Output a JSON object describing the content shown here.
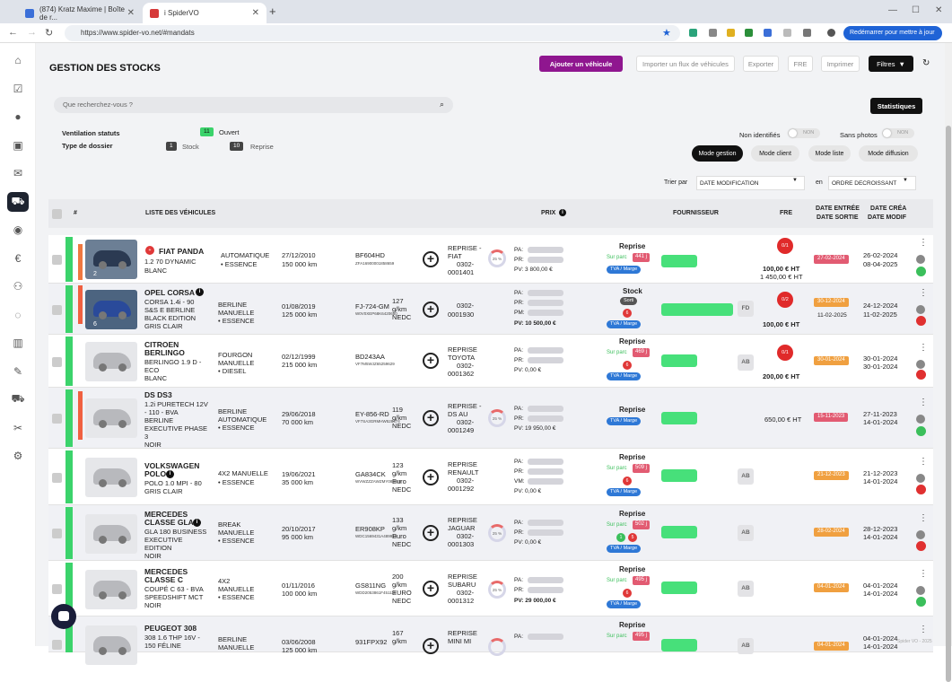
{
  "browser": {
    "tabs": [
      {
        "label": "(874) Kratz Maxime | Boîte de r..."
      },
      {
        "label": "i SpiderVO"
      }
    ],
    "url": "https://www.spider-vo.net/#mandats",
    "update_label": "Redémarrer pour mettre à jour"
  },
  "page": {
    "title": "GESTION DES STOCKS",
    "buttons": {
      "add": "Ajouter un véhicule",
      "import": "Importer un flux de véhicules",
      "export": "Exporter",
      "fre": "FRE",
      "print": "Imprimer",
      "filters": "Filtres"
    },
    "search_placeholder": "Que recherchez-vous ?",
    "stats": "Statistiques",
    "ventilation_label": "Ventilation statuts",
    "ventilation_count": "11",
    "ventilation_status": "Ouvert",
    "dossier_label": "Type de dossier",
    "dossier_stock_count": "1",
    "dossier_stock": "Stock",
    "dossier_reprise_count": "10",
    "dossier_reprise": "Reprise",
    "non_identifies": "Non identifiés",
    "sans_photos": "Sans photos",
    "toggle_off": "NON",
    "modes": [
      "Mode gestion",
      "Mode client",
      "Mode liste",
      "Mode diffusion"
    ],
    "sort_label": "Trier par",
    "sort_value": "DATE MODIFICATION",
    "order_label": "en",
    "order_value": "ORDRE DECROISSANT",
    "copyright": "Spider VO - 2025"
  },
  "table": {
    "headers": {
      "num": "#",
      "vehicles": "LISTE DES VÉHICULES",
      "price": "PRIX",
      "supplier": "FOURNISSEUR",
      "fre": "FRE",
      "entry_1": "DATE ENTRÉE",
      "entry_2": "DATE SORTIE",
      "created_1": "DATE CRÉA",
      "created_2": "DATE MODIF"
    },
    "rows": [
      {
        "n": "1",
        "name": "FIAT PANDA",
        "v1": "1.2 70 DYNAMIC",
        "v2": "BLANC",
        "v3": "",
        "gear1": "AUTOMATIQUE",
        "gear2": "• ESSENCE",
        "gear3": "",
        "date": "27/12/2010",
        "km": "150 000 km",
        "plate": "BF604HD",
        "vin": "ZFA16900001858659",
        "co2a": "",
        "co2b": "",
        "co2c": "",
        "origin1": "REPRISE -",
        "origin2": "FIAT",
        "origin3": "0302-",
        "origin4": "0001401",
        "ring": "25 %",
        "pa": "PA:",
        "pr": "PR:",
        "pv": "PV: 3 800,00 €",
        "type": "Reprise",
        "sur": "Sur parc",
        "days": "441 j",
        "tva": "TVA / Marge",
        "fre": "0/1",
        "fre_ht1": "100,00 € HT",
        "fre_ht2": "1 450,00 € HT",
        "entry": "27-02-2024",
        "exit": "",
        "created": "26-02-2024",
        "modified": "08-04-2025",
        "photos": "2",
        "ab": ""
      },
      {
        "n": "2",
        "name": "OPEL CORSA",
        "v1": "CORSA 1.4i - 90",
        "v2": "S&S E BERLINE",
        "v3": "BLACK EDITION",
        "v4": "GRIS CLAIR",
        "gear1": "BERLINE",
        "gear2": "MANUELLE",
        "gear3": "• ESSENCE",
        "date": "01/08/2019",
        "km": "125 000 km",
        "plate": "FJ-724-GM",
        "vin": "W0V0XEP68K6420650",
        "co2a": "127",
        "co2b": "g/km",
        "co2c": "NEDC",
        "origin1": "0302-",
        "origin2": "0001930",
        "origin3": "",
        "origin4": "",
        "ring": "",
        "pa": "PA:",
        "pr": "PR:",
        "pm": "PM:",
        "pv": "PV: 10 500,00 €",
        "type": "Stock",
        "sorti": "Sorti",
        "tva": "TVA / Marge",
        "fre": "0/2",
        "fre_ht1": "100,00 € HT",
        "fre_ht2": "",
        "entry": "30-12-2024",
        "exit": "11-02-2025",
        "created": "24-12-2024",
        "modified": "11-02-2025",
        "photos": "6",
        "ab": "FD"
      },
      {
        "n": "3",
        "name": "CITROEN",
        "name2": "BERLINGO",
        "v1": "BERLINGO 1.9 D -",
        "v2": "ECO",
        "v3": "BLANC",
        "gear1": "FOURGON",
        "gear2": "MANUELLE",
        "gear3": "• DIESEL",
        "date": "02/12/1999",
        "km": "215 000 km",
        "plate": "BD243AA",
        "vin": "VF7M5WJZ65259629",
        "origin1": "REPRISE",
        "origin2": "TOYOTA",
        "origin3": "0302-",
        "origin4": "0001362",
        "pa": "PA:",
        "pr": "PR:",
        "pv": "PV: 0,00 €",
        "type": "Reprise",
        "sur": "Sur parc",
        "days": "469 j",
        "tva": "TVA / Marge",
        "fre": "0/1",
        "fre_ht1": "200,00 € HT",
        "entry": "30-01-2024",
        "created": "30-01-2024",
        "modified": "30-01-2024",
        "ab": "AB"
      },
      {
        "n": "4",
        "name": "DS DS3",
        "v1": "1.2i PURETECH 12V",
        "v2": "- 110 - BVA",
        "v3": "BERLINE",
        "v4": "EXECUTIVE PHASE",
        "v5": "3",
        "v6": "NOIR",
        "gear1": "BERLINE",
        "gear2": "AUTOMATIQUE",
        "gear3": "• ESSENCE",
        "date": "29/06/2018",
        "km": "70 000 km",
        "plate": "EY-856-RD",
        "vin": "VF7SA3GRMHW528474",
        "co2a": "119",
        "co2b": "g/km",
        "co2c": "NEDC",
        "origin1": "REPRISE -",
        "origin2": "DS AU",
        "origin3": "0302-",
        "origin4": "0001249",
        "ring": "25 %",
        "pa": "PA:",
        "pr": "PR:",
        "pv": "PV: 19 950,00 €",
        "type": "Reprise",
        "tva": "TVA / Marge",
        "fre_ht1": "650,00 € HT",
        "entry": "15-11-2023",
        "created": "27-11-2023",
        "modified": "14-01-2024"
      },
      {
        "n": "5",
        "name": "VOLKSWAGEN",
        "name2": "POLO",
        "v1": "POLO 1.0 MPI - 80",
        "v2": "GRIS CLAIR",
        "gear1": "4X2 MANUELLE",
        "gear2": "• ESSENCE",
        "date": "19/06/2021",
        "km": "35 000 km",
        "plate": "GA834CK",
        "vin": "WVWZZZAWZMY088029",
        "co2a": "123",
        "co2b": "g/km",
        "co2c": "Euro",
        "co2d": "NEDC",
        "origin1": "REPRISE",
        "origin2": "RENAULT",
        "origin3": "0302-",
        "origin4": "0001292",
        "pa": "PA:",
        "pr": "PR:",
        "vm": "VM:",
        "pv": "PV: 0,00 €",
        "type": "Reprise",
        "sur": "Sur parc",
        "days": "509 j",
        "tva": "TVA / Marge",
        "entry": "21-12-2023",
        "created": "21-12-2023",
        "modified": "14-01-2024",
        "ab": "AB"
      },
      {
        "n": "6",
        "name": "MERCEDES",
        "name2": "CLASSE GLA",
        "v1": "GLA 180 BUSINESS",
        "v2": "EXECUTIVE",
        "v3": "EDITION",
        "v4": "NOIR",
        "gear1": "BREAK",
        "gear2": "MANUELLE",
        "gear3": "• ESSENCE",
        "date": "20/10/2017",
        "km": "95 000 km",
        "plate": "ER908KP",
        "vin": "WDC1569431A489919",
        "co2a": "133",
        "co2b": "g/km",
        "co2c": "Euro",
        "co2d": "NEDC",
        "origin1": "REPRISE",
        "origin2": "JAGUAR",
        "origin3": "0302-",
        "origin4": "0001303",
        "ring": "25 %",
        "pa": "PA:",
        "pr": "PR:",
        "pv": "PV: 0,00 €",
        "type": "Reprise",
        "sur": "Sur parc",
        "days": "502 j",
        "tva": "TVA / Marge",
        "entry": "28-02-2024",
        "created": "28-12-2023",
        "modified": "14-01-2024",
        "ab": "AB"
      },
      {
        "n": "7",
        "name": "MERCEDES",
        "name2": "CLASSE C",
        "v1": "COUPÉ C 63 - BVA",
        "v2": "SPEEDSHIFT MCT",
        "v3": "NOIR",
        "gear1": "4X2",
        "gear2": "MANUELLE",
        "gear3": "• ESSENCE",
        "date": "01/11/2016",
        "km": "100 000 km",
        "plate": "GS811NG",
        "vin": "WDD2053861F451116",
        "co2a": "200",
        "co2b": "g/km",
        "co2c": "EURO",
        "co2d": "NEDC",
        "origin1": "REPRISE",
        "origin2": "SUBARU",
        "origin3": "0302-",
        "origin4": "0001312",
        "ring": "25 %",
        "pa": "PA:",
        "pr": "PR:",
        "pv": "PV: 29 000,00 €",
        "type": "Reprise",
        "sur": "Sur parc",
        "days": "495 j",
        "tva": "TVA / Marge",
        "entry": "04-01-2024",
        "created": "04-01-2024",
        "modified": "14-01-2024",
        "ab": "AB"
      },
      {
        "n": "8",
        "name": "PEUGEOT 308",
        "v1": "308 1.6 THP 16V -",
        "v2": "150 FÉLINE",
        "gear1": "BERLINE",
        "gear2": "MANUELLE",
        "date": "03/06/2008",
        "km": "125 000 km",
        "plate": "931FPX92",
        "co2a": "167",
        "co2b": "g/km",
        "origin1": "REPRISE",
        "origin2": "MINI MI",
        "pa": "PA:",
        "type": "Reprise",
        "sur": "Sur parc",
        "days": "495 j",
        "entry": "04-01-2024",
        "created": "04-01-2024",
        "modified": "14-01-2024",
        "ab": "AB"
      }
    ]
  }
}
